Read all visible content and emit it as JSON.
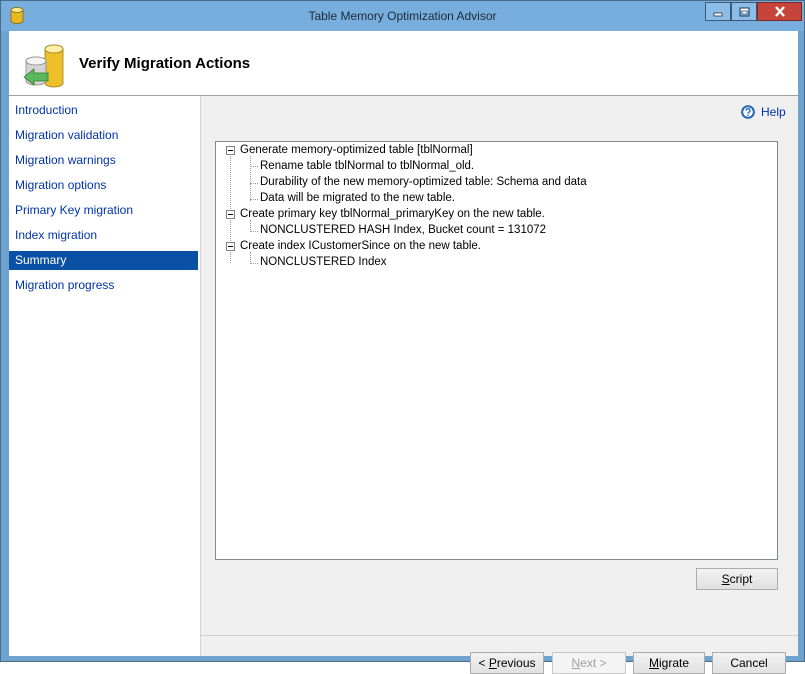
{
  "window": {
    "title": "Table Memory Optimization Advisor",
    "accent_color": "#78aede",
    "close_color": "#c7443a"
  },
  "header": {
    "title": "Verify Migration Actions",
    "icon": "database-migration-icon"
  },
  "nav": {
    "selected_color": "#0a50a4",
    "items": [
      {
        "label": "Introduction",
        "selected": false
      },
      {
        "label": "Migration validation",
        "selected": false
      },
      {
        "label": "Migration warnings",
        "selected": false
      },
      {
        "label": "Migration options",
        "selected": false
      },
      {
        "label": "Primary Key migration",
        "selected": false
      },
      {
        "label": "Index migration",
        "selected": false
      },
      {
        "label": "Summary",
        "selected": true
      },
      {
        "label": "Migration progress",
        "selected": false
      }
    ]
  },
  "help": {
    "label": "Help",
    "icon": "help-question-icon"
  },
  "tree": {
    "nodes": [
      {
        "label": "Generate memory-optimized table [tblNormal]",
        "expanded": true,
        "children": [
          "Rename table tblNormal to tblNormal_old.",
          "Durability of the new memory-optimized table: Schema and data",
          "Data will be migrated to the new table."
        ]
      },
      {
        "label": "Create primary key tblNormal_primaryKey on the new table.",
        "expanded": true,
        "children": [
          "NONCLUSTERED HASH Index, Bucket count = 131072"
        ]
      },
      {
        "label": "Create index ICustomerSince on the new table.",
        "expanded": true,
        "children": [
          "NONCLUSTERED Index"
        ]
      }
    ]
  },
  "buttons": {
    "script": {
      "mnemonic": "S",
      "rest": "cript"
    },
    "previous": {
      "prefix": "< ",
      "mnemonic": "P",
      "rest": "revious"
    },
    "next": {
      "mnemonic": "N",
      "rest": "ext >",
      "enabled": false
    },
    "migrate": {
      "mnemonic": "M",
      "rest": "igrate"
    },
    "cancel": {
      "label": "Cancel"
    }
  }
}
